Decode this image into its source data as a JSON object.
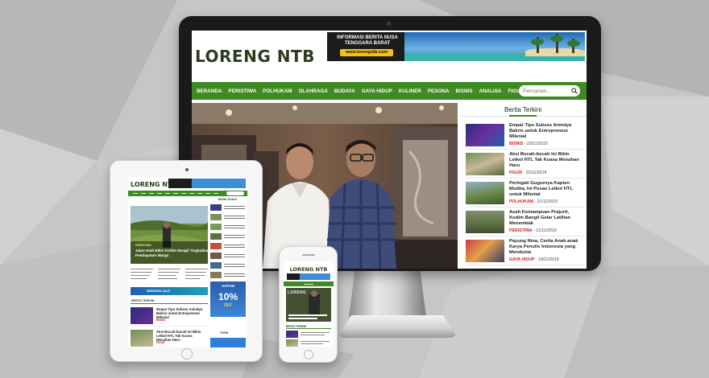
{
  "desktop": {
    "logo": "LORENG NTB",
    "banner": {
      "headline": "INFORMASI BERITA NUSA TENGGARA BARAT",
      "url": "www.lorengntb.com"
    },
    "nav": [
      "BERANDA",
      "PERISTIWA",
      "POLHUKAM",
      "OLAHRAGA",
      "BUDAYA",
      "GAYA HIDUP",
      "KULINER",
      "PESONA",
      "BISNIS",
      "ANALISA",
      "FIGUR"
    ],
    "search_placeholder": "Pencarian...",
    "sidebar": {
      "title": "Berita Terkini",
      "items": [
        {
          "title": "Empat Tips Sukses Anindya Bakrie untuk Entrepreneur Milenial",
          "category": "BISNIS",
          "date": "23/11/2019"
        },
        {
          "title": "Aksi Bocah-bocah Ini Bikin Letkol HTL Tak Kuasa Menahan Haru",
          "category": "FIGUR",
          "date": "23/11/2019"
        },
        {
          "title": "Peringati Gugurnya Kapten Mudita, Ini Pesan Letkol HTL untuk Milenial",
          "category": "POLHUKAM",
          "date": "21/11/2019"
        },
        {
          "title": "Asah Kemampuan Prajurit, Kodim Bangli Gelar Latihan Menembak",
          "category": "PERISTIWA",
          "date": "21/11/2019"
        },
        {
          "title": "Payung Nina, Cerita Anak-anak Karya Penulis Indonesia yang Mendunia",
          "category": "GAYA HIDUP",
          "date": "19/11/2019"
        }
      ]
    }
  },
  "tablet": {
    "logo": "LORENG NTB",
    "featured_category": "PERISTIWA",
    "featured_title": "Jalan Hadi Bikin Kodim Bangli Tingkatkan Pendapatan Warga",
    "sidebar_title": "Berita Terkini",
    "sale_label": "WEEKEND SALE",
    "ad": {
      "brand": "ASTON",
      "discount": "10%",
      "label": "OFF"
    },
    "berita_heading": "BERITA TERKINI",
    "items": [
      {
        "title": "Empat Tips Sukses Anindya Bakrie untuk Entrepreneur Milenial",
        "meta": "BISNIS"
      },
      {
        "title": "Aksi Bocah-bocah Ini Bikin Letkol HTL Tak Kuasa Menahan Haru",
        "meta": "FIGUR"
      }
    ],
    "topik_label": "TOPIK"
  },
  "phone": {
    "logo": "LORENG NTB",
    "featured_word": "LORENG",
    "berita_heading": "BERITA TERKINI"
  },
  "colors": {
    "nav_green": "#3f8a22",
    "category_red": "#d32020",
    "background": "#bdbdbd"
  }
}
